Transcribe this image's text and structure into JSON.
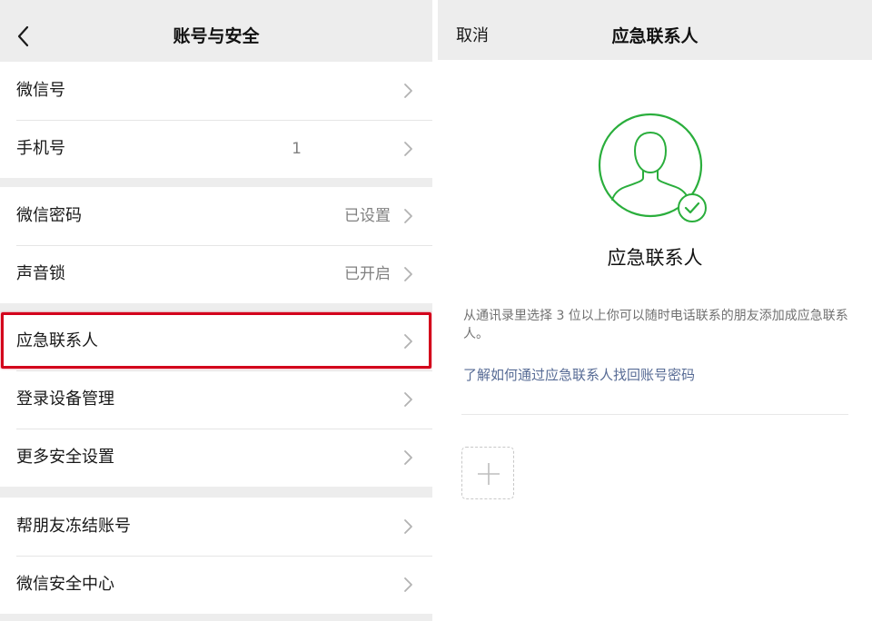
{
  "left": {
    "title": "账号与安全",
    "groups": [
      [
        {
          "label": "微信号",
          "value": ""
        },
        {
          "label": "手机号",
          "value": "1"
        }
      ],
      [
        {
          "label": "微信密码",
          "value": "已设置"
        },
        {
          "label": "声音锁",
          "value": "已开启"
        }
      ],
      [
        {
          "label": "应急联系人",
          "value": ""
        },
        {
          "label": "登录设备管理",
          "value": ""
        },
        {
          "label": "更多安全设置",
          "value": ""
        }
      ],
      [
        {
          "label": "帮朋友冻结账号",
          "value": ""
        },
        {
          "label": "微信安全中心",
          "value": ""
        }
      ]
    ]
  },
  "right": {
    "cancel_label": "取消",
    "title": "应急联系人",
    "heading": "应急联系人",
    "description": "从通讯录里选择 3 位以上你可以随时电话联系的朋友添加成应急联系人。",
    "help_link": "了解如何通过应急联系人找回账号密码"
  },
  "colors": {
    "accent_green": "#2aae3c",
    "link_blue": "#576b95",
    "highlight_red": "#d3001b"
  },
  "icons": {
    "back": "chevron-left-icon",
    "row_arrow": "chevron-right-icon",
    "avatar": "user-avatar-icon",
    "check": "check-circle-icon",
    "add": "plus-icon"
  }
}
